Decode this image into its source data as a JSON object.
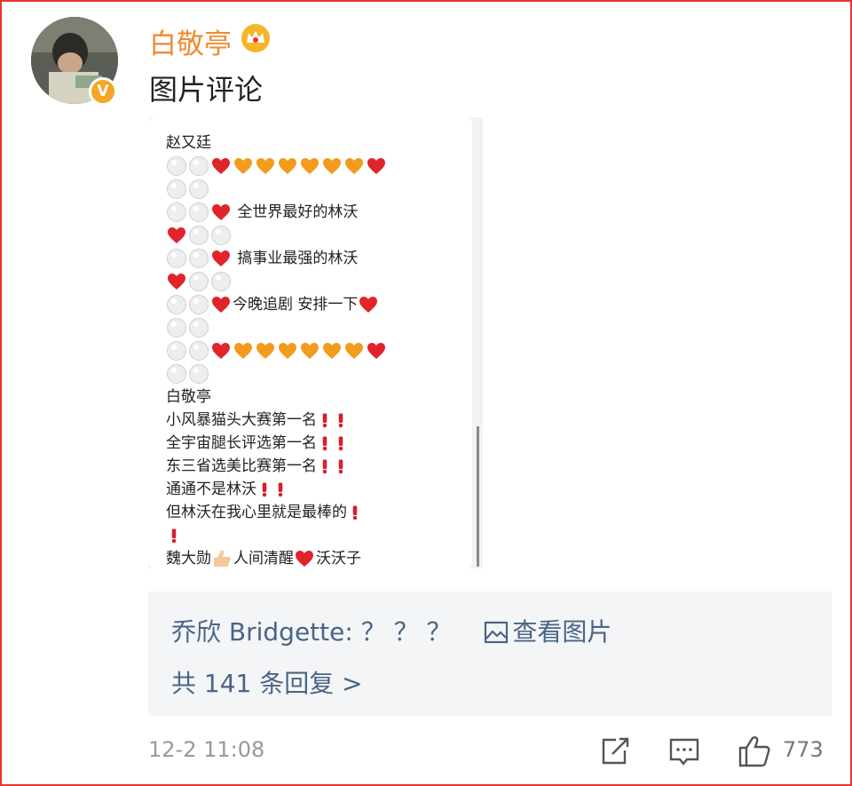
{
  "post": {
    "username": "白敬亭",
    "content": "图片评论",
    "avatar_badge": "V"
  },
  "image": {
    "lines": [
      {
        "t": "赵又廷"
      },
      {
        "e": [
          "w",
          "w",
          "r",
          "o",
          "o",
          "o",
          "o",
          "o",
          "o",
          "r"
        ]
      },
      {
        "e": [
          "w",
          "w"
        ]
      },
      {
        "e": [
          "w",
          "w",
          "r"
        ],
        "t": " 全世界最好的林沃"
      },
      {
        "e": [
          "r",
          "w",
          "w"
        ]
      },
      {
        "e": [
          "w",
          "w",
          "r"
        ],
        "t": " 搞事业最强的林沃"
      },
      {
        "e": [
          "r",
          "w",
          "w"
        ]
      },
      {
        "e": [
          "w",
          "w",
          "r"
        ],
        "t": "今晚追剧 安排一下",
        "e2": [
          "r"
        ]
      },
      {
        "e": [
          "w",
          "w"
        ]
      },
      {
        "e": [
          "w",
          "w",
          "r",
          "o",
          "o",
          "o",
          "o",
          "o",
          "o",
          "r"
        ]
      },
      {
        "e": [
          "w",
          "w"
        ]
      },
      {
        "t": "白敬亭"
      },
      {
        "t": "小风暴猫头大赛第一名",
        "x": 2
      },
      {
        "t": "全宇宙腿长评选第一名",
        "x": 2
      },
      {
        "t": "东三省选美比赛第一名",
        "x": 2
      },
      {
        "t": "通通不是林沃",
        "x": 2
      },
      {
        "t": "但林沃在我心里就是最棒的",
        "x": 1
      },
      {
        "x": 1
      },
      {
        "t": "魏大勋",
        "thumb": true,
        "t2": "人间清醒",
        "heart": true,
        "t3": "沃沃子"
      }
    ]
  },
  "reply": {
    "author_text": "乔欣 Bridgette: ？ ？ ？",
    "view_picture": "查看图片",
    "count_text": "共 141 条回复 >"
  },
  "footer": {
    "time": "12-2 11:08",
    "likes": "773",
    "icons": [
      "share-icon",
      "comment-icon",
      "like-icon"
    ]
  },
  "colors": {
    "username": "#f08a30",
    "link": "#4a6487",
    "border": "#e8352e"
  }
}
